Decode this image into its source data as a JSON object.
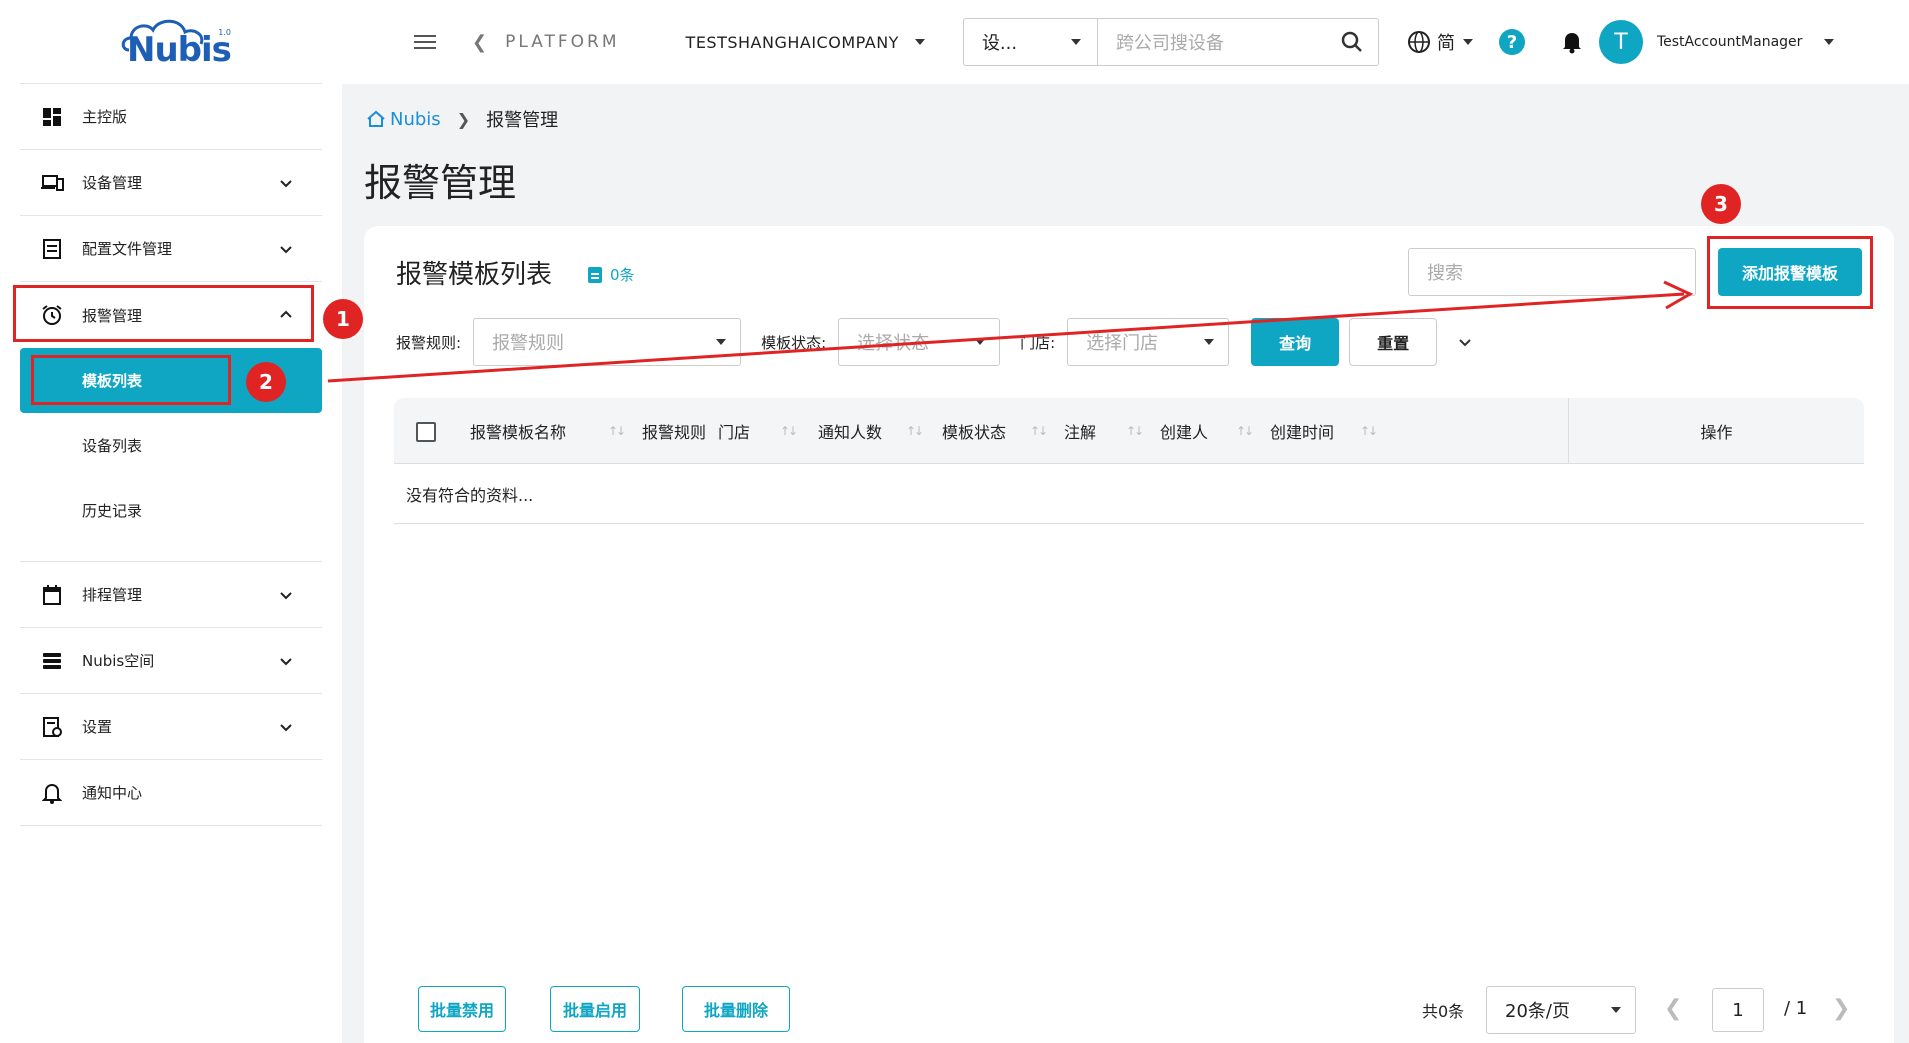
{
  "brand": {
    "logo_text": "Nubis",
    "logo_version": "1.0"
  },
  "sidebar": {
    "items": [
      {
        "label": "主控版",
        "icon": "dashboard-icon"
      },
      {
        "label": "设备管理",
        "icon": "devices-icon"
      },
      {
        "label": "配置文件管理",
        "icon": "config-file-icon"
      },
      {
        "label": "报警管理",
        "icon": "alarm-clock-icon"
      },
      {
        "label": "排程管理",
        "icon": "calendar-icon"
      },
      {
        "label": "Nubis空间",
        "icon": "storage-icon"
      },
      {
        "label": "设置",
        "icon": "settings-doc-icon"
      },
      {
        "label": "通知中心",
        "icon": "bell-icon"
      }
    ],
    "sub_items": [
      {
        "label": "模板列表",
        "active": true
      },
      {
        "label": "设备列表"
      },
      {
        "label": "历史记录"
      }
    ]
  },
  "topbar": {
    "platform_label": "PLATFORM",
    "company": "TESTSHANGHAICOMPANY",
    "search_type": "设...",
    "search_placeholder": "跨公司搜设备",
    "language": "简",
    "help": "?",
    "avatar_initial": "T",
    "username": "TestAccountManager"
  },
  "breadcrumb": {
    "home": "Nubis",
    "current": "报警管理"
  },
  "page_title": "报警管理",
  "card": {
    "title": "报警模板列表",
    "count": "0条",
    "search_placeholder": "搜索",
    "add_button": "添加报警模板"
  },
  "filters": {
    "rule_label": "报警规则:",
    "rule_placeholder": "报警规则",
    "status_label": "模板状态:",
    "status_placeholder": "选择状态",
    "store_label": "门店:",
    "store_placeholder": "选择门店",
    "query_button": "查询",
    "reset_button": "重置"
  },
  "table": {
    "columns": [
      "报警模板名称",
      "报警规则",
      "门店",
      "通知人数",
      "模板状态",
      "注解",
      "创建人",
      "创建时间"
    ],
    "ops_column": "操作",
    "empty_text": "没有符合的资料..."
  },
  "bulk_actions": {
    "disable": "批量禁用",
    "enable": "批量启用",
    "delete": "批量删除"
  },
  "pagination": {
    "total": "共0条",
    "per_page": "20条/页",
    "current_page": "1",
    "of_total": "/ 1"
  },
  "annotations": {
    "step1": "1",
    "step2": "2",
    "step3": "3",
    "color": "#e02424"
  },
  "colors": {
    "accent": "#0fa6c4",
    "link": "#1a8fd8",
    "brand": "#1d5fb5"
  }
}
